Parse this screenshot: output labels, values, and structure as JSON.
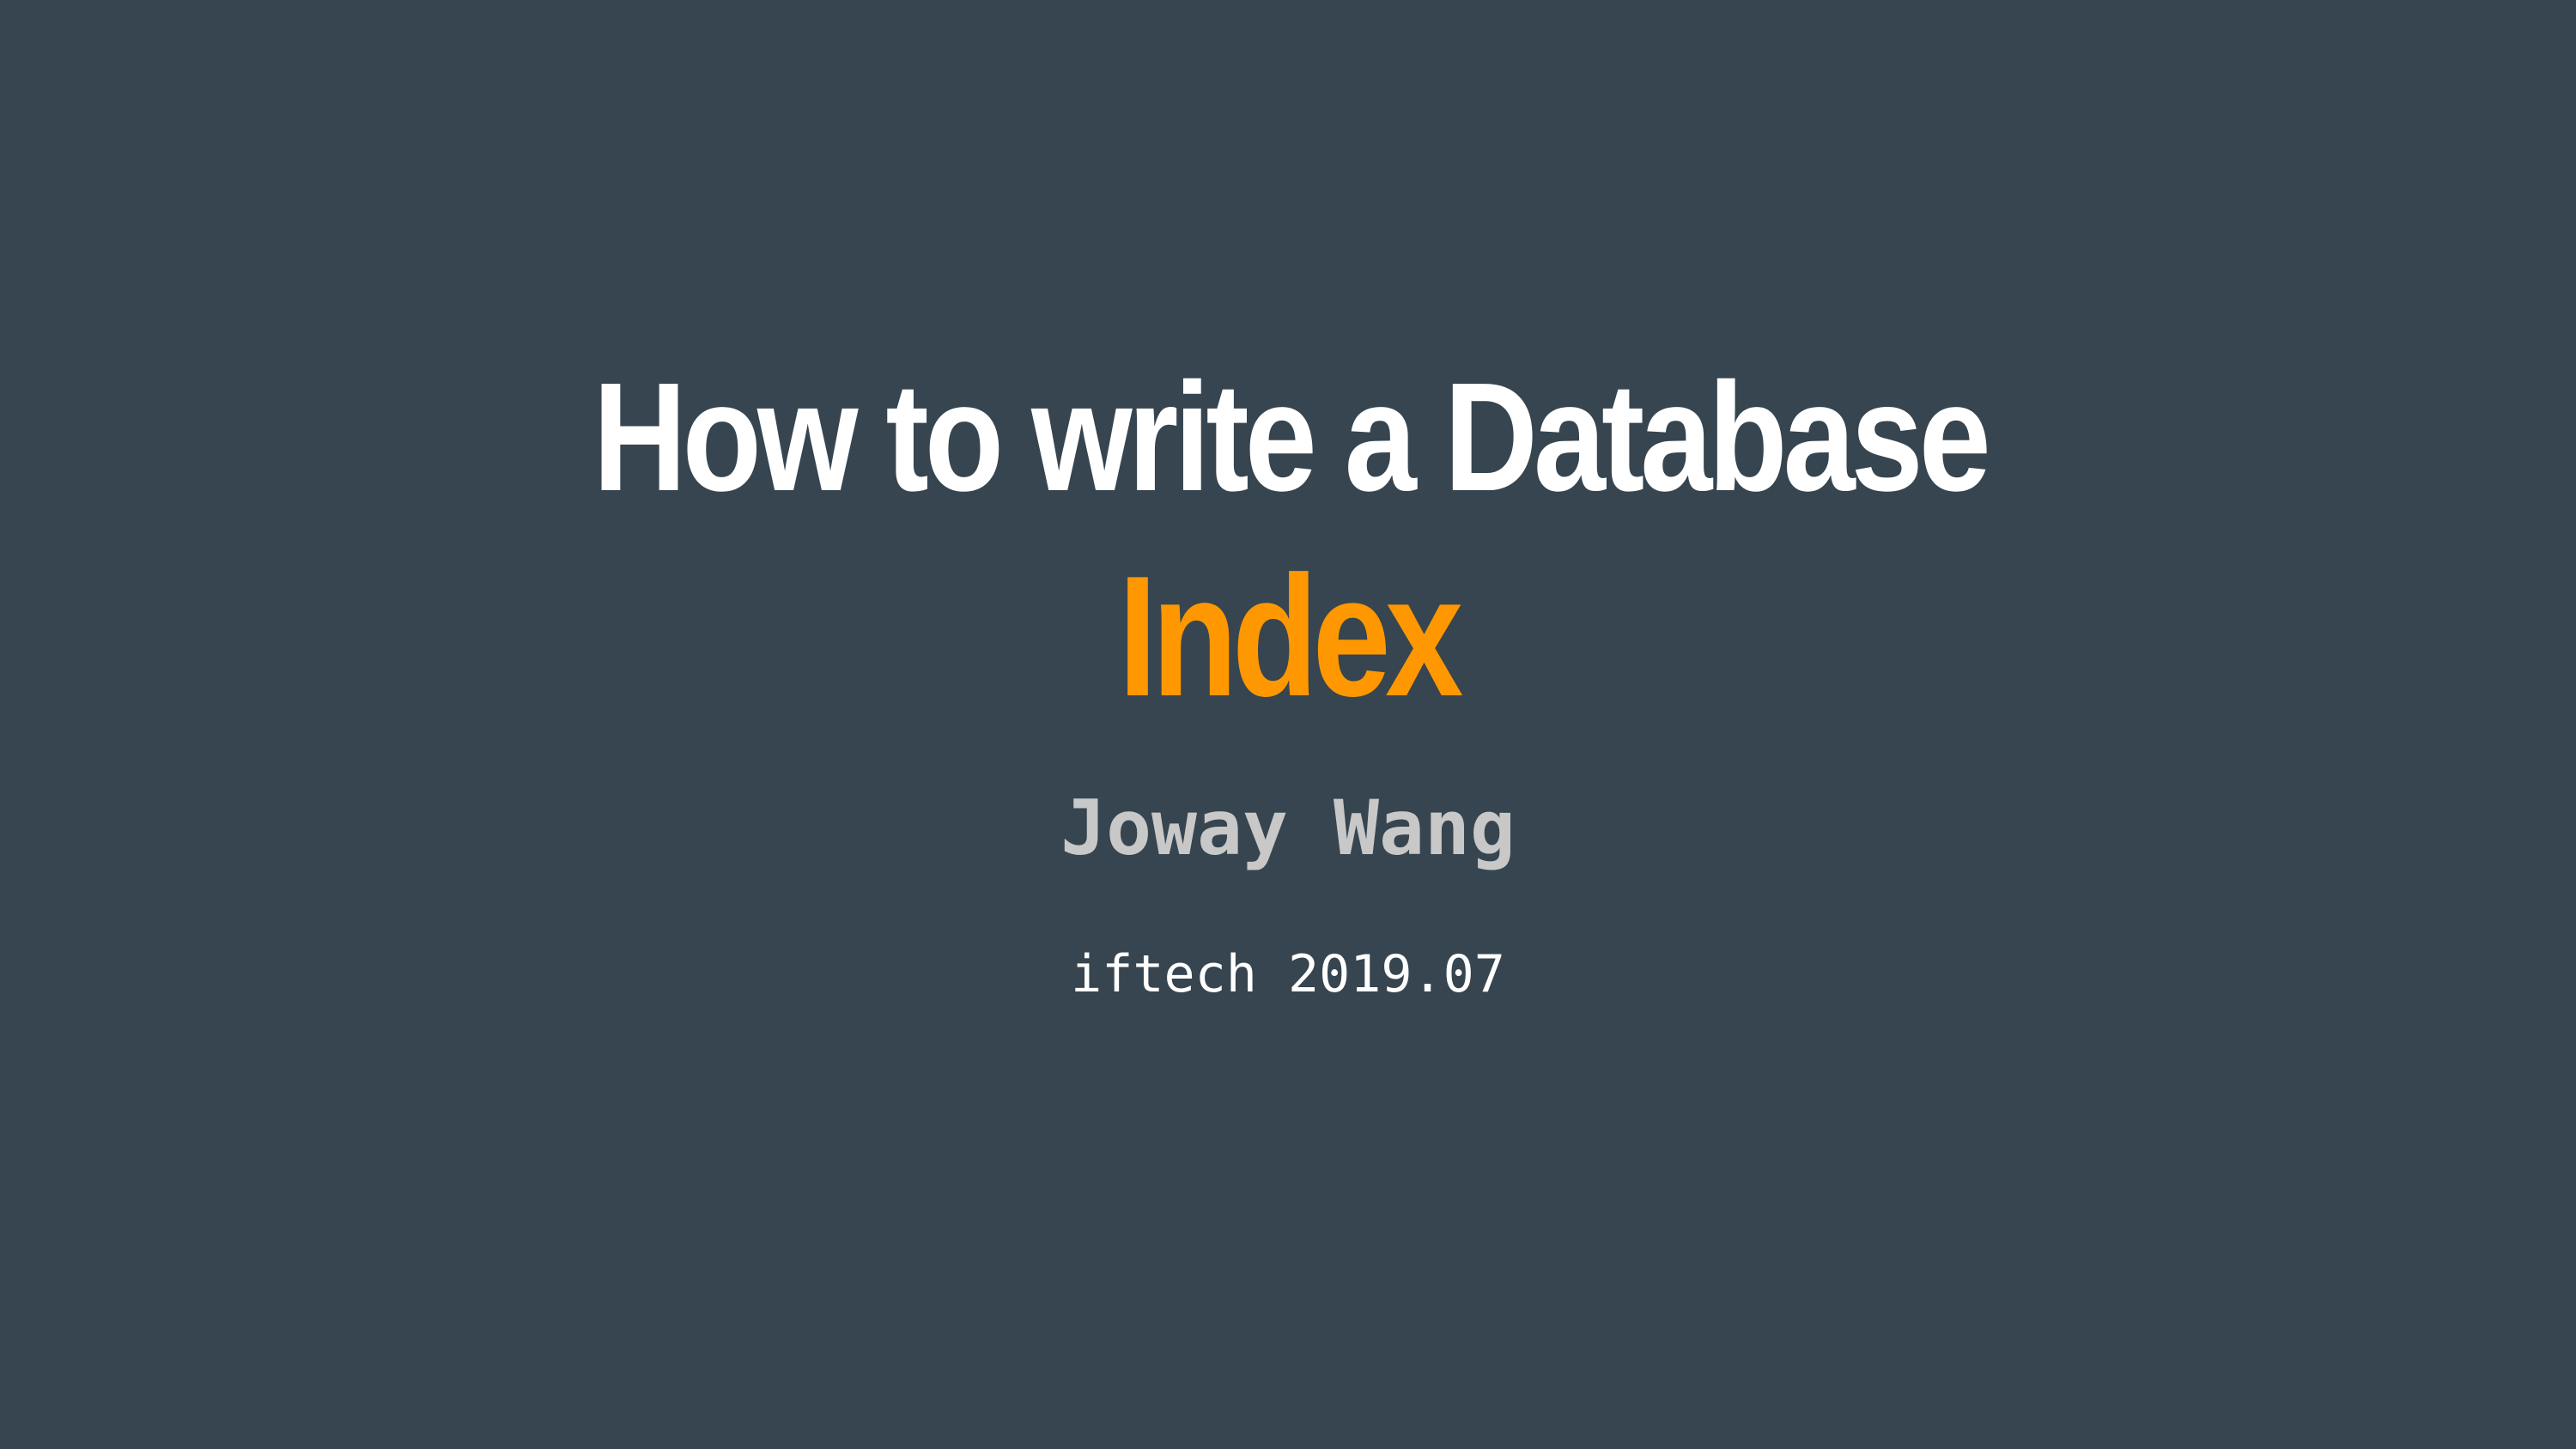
{
  "slide": {
    "title": "How to write a Database",
    "title_accent": "Index",
    "author": "Joway Wang",
    "footer": "iftech 2019.07"
  },
  "colors": {
    "background": "#36454f",
    "title": "#ffffff",
    "accent": "#ff9800",
    "author": "#c8c8c8",
    "footer": "#ffffff"
  }
}
